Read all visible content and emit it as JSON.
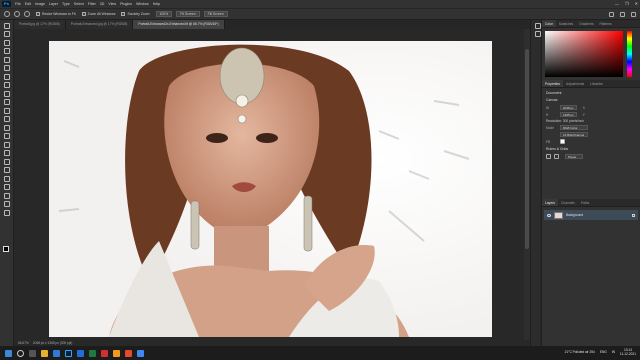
{
  "menubar": {
    "logo": "Ps",
    "items": [
      "File",
      "Edit",
      "Image",
      "Layer",
      "Type",
      "Select",
      "Filter",
      "3D",
      "View",
      "Plugins",
      "Window",
      "Help"
    ],
    "window_controls": [
      "—",
      "❐",
      "✕"
    ]
  },
  "options": {
    "resize_windows": "Resize Windows to Fit",
    "zoom_all": "Zoom All Windows",
    "scrubby_zoom": "Scrubby Zoom",
    "zoom_value": "100%",
    "fit_screen": "Fit Screen",
    "fill_screen": "Fill Screen"
  },
  "tabs": [
    {
      "label": "Portrait.jpg @ 17% (RGB/8)",
      "active": false
    },
    {
      "label": "Portrait-Enhanced.jpg @ 17% (RGB/8)",
      "active": false
    },
    {
      "label": "Portrait-Enhanced2x-Enhanced.tif @ 66.7% (RGB/16*)",
      "active": true
    }
  ],
  "status": {
    "zoom": "66.67%",
    "doc_info": "2048 px x 1365 px (300 ppi)"
  },
  "color_panel": {
    "tabs": [
      "Color",
      "Swatches",
      "Gradients",
      "Patterns"
    ]
  },
  "properties_panel": {
    "tabs": [
      "Properties",
      "Adjustments",
      "Libraries"
    ],
    "document_label": "Document",
    "canvas_title": "Canvas",
    "w_label": "W",
    "w_value": "2048 px",
    "h_label": "H",
    "h_value": "1365 px",
    "x_label": "X",
    "y_label": "Y",
    "resolution": "Resolution: 300 pixels/inch",
    "mode_label": "Mode",
    "mode_value": "RGB Color",
    "bit_value": "16 Bits/Channel",
    "fill_label": "Fill",
    "rulers_title": "Rulers & Grids",
    "rulers_unit": "Pixels"
  },
  "layers_panel": {
    "tabs": [
      "Layers",
      "Channels",
      "Paths"
    ],
    "layer_name": "Background"
  },
  "taskbar": {
    "weather": "21°C  Polluted air 254",
    "lang": "ENG",
    "region": "IN",
    "time": "13:13",
    "date": "11-12-2021"
  },
  "colors": {
    "ps_blue": "#31a8ff",
    "selected_layer": "#3d4a58"
  }
}
